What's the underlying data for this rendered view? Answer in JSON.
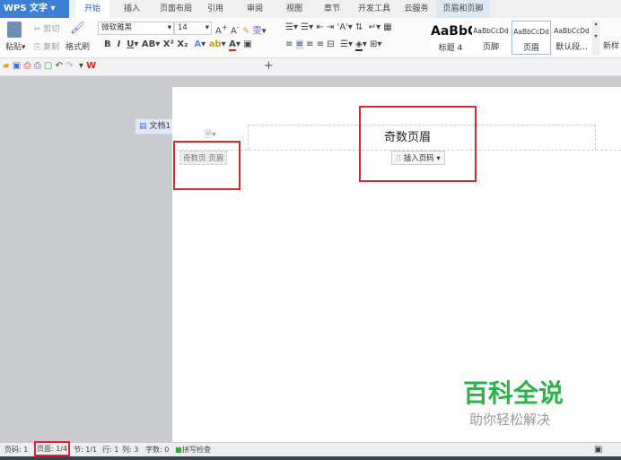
{
  "app": {
    "title": "WPS 文字"
  },
  "tabs": [
    "开始",
    "插入",
    "页面布局",
    "引用",
    "审阅",
    "视图",
    "章节",
    "开发工具",
    "云服务",
    "页眉和页脚"
  ],
  "ribbon": {
    "paste": "粘贴",
    "cut": "剪切",
    "copy": "复制",
    "format_painter": "格式刷",
    "font": "微软雅黑",
    "size": "14",
    "styles": [
      {
        "preview": "AaBbC",
        "label": "标题 4"
      },
      {
        "preview": "AaBbCcDd",
        "label": "页脚"
      },
      {
        "preview": "AaBbCcDd",
        "label": "页眉"
      },
      {
        "preview": "AaBbCcDd",
        "label": "默认段..."
      }
    ],
    "new_style": "新样"
  },
  "doc_tab": {
    "label": "文档1 *"
  },
  "header": {
    "title": "奇数页眉",
    "tag": "奇数页 页眉",
    "insert_page_number": "插入页码"
  },
  "watermark": {
    "brand": "百科全说",
    "slogan": "助你轻松解决"
  },
  "status": {
    "page_num": "页码: 1",
    "page": "页面: 1/4",
    "section": "节: 1/1",
    "row": "行: 1",
    "col": "列: 3",
    "words": "字数: 0",
    "spell": "拼写检查"
  },
  "colors": {
    "accent": "#3e7fd6",
    "highlight": "#d8262b",
    "watermark": "#2db24a"
  }
}
